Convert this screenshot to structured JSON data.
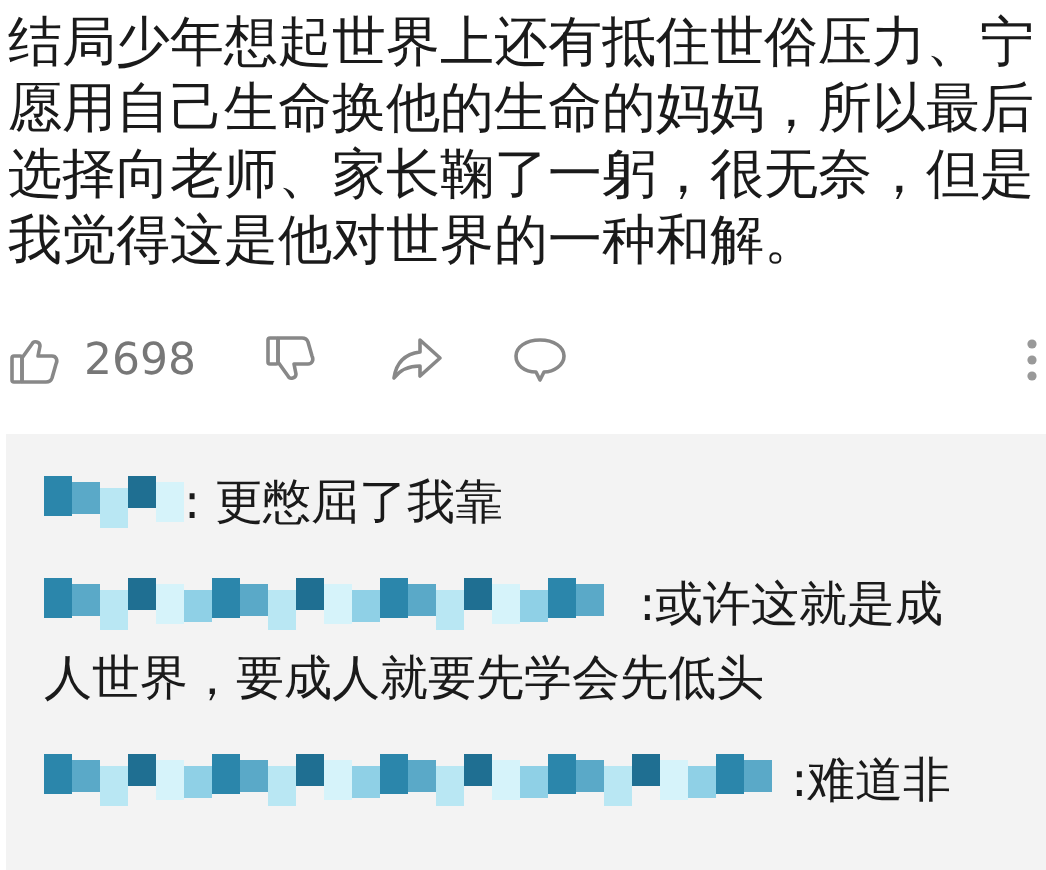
{
  "comment": {
    "text": "结局少年想起世界上还有抵住世俗压力、宁愿用自己生命换他的生命的妈妈，所以最后选择向老师、家长鞠了一躬，很无奈，但是我觉得这是他对世界的一种和解。"
  },
  "actions": {
    "likes": "2698"
  },
  "replies": [
    {
      "author": {
        "kind": "short"
      },
      "text": ": 更憋屈了我靠"
    },
    {
      "author": {
        "kind": "medium"
      },
      "text": " :或许这就是成",
      "continued": "人世界，要成人就要先学会先低头"
    },
    {
      "author": {
        "kind": "long"
      },
      "text": " :难道非"
    }
  ]
}
